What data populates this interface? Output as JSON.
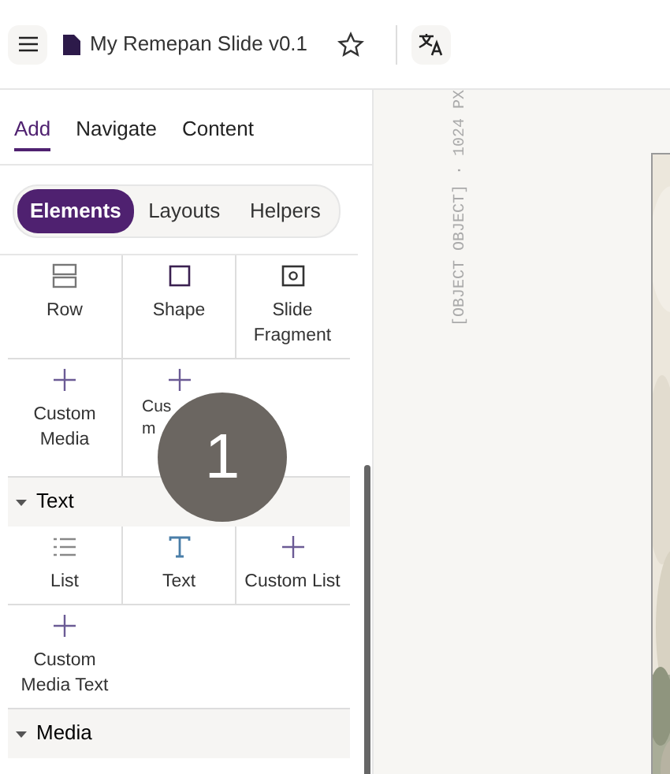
{
  "header": {
    "title": "My Remepan Slide v0.1",
    "starred": false
  },
  "tabs": [
    {
      "label": "Add",
      "selected": true
    },
    {
      "label": "Navigate",
      "selected": false
    },
    {
      "label": "Content",
      "selected": false
    }
  ],
  "segments": [
    {
      "label": "Elements",
      "selected": true
    },
    {
      "label": "Layouts",
      "selected": false
    },
    {
      "label": "Helpers",
      "selected": false
    }
  ],
  "panel_items": [
    {
      "kind": "tiles",
      "tiles": [
        {
          "kind": "row",
          "label": "Row"
        },
        {
          "kind": "shape",
          "label": "Shape"
        },
        {
          "kind": "fragment",
          "label": "Slide Fragment"
        }
      ]
    },
    {
      "kind": "tiles",
      "tiles": [
        {
          "kind": "plus",
          "label": "Custom Media"
        },
        {
          "kind": "plus",
          "label": "Cus\nm"
        }
      ]
    },
    {
      "kind": "section",
      "title": "Text",
      "expanded": true
    },
    {
      "kind": "tiles",
      "tiles": [
        {
          "kind": "list",
          "label": "List"
        },
        {
          "kind": "text",
          "label": "Text"
        },
        {
          "kind": "plus",
          "label": "Custom List"
        }
      ]
    },
    {
      "kind": "tiles",
      "tiles": [
        {
          "kind": "plus",
          "label": "Custom Media Text"
        }
      ]
    },
    {
      "kind": "section",
      "title": "Media",
      "expanded": true
    }
  ],
  "step_badge": "1",
  "canvas": {
    "ruler_label": "[OBJECT OBJECT] · 1024 PX"
  }
}
